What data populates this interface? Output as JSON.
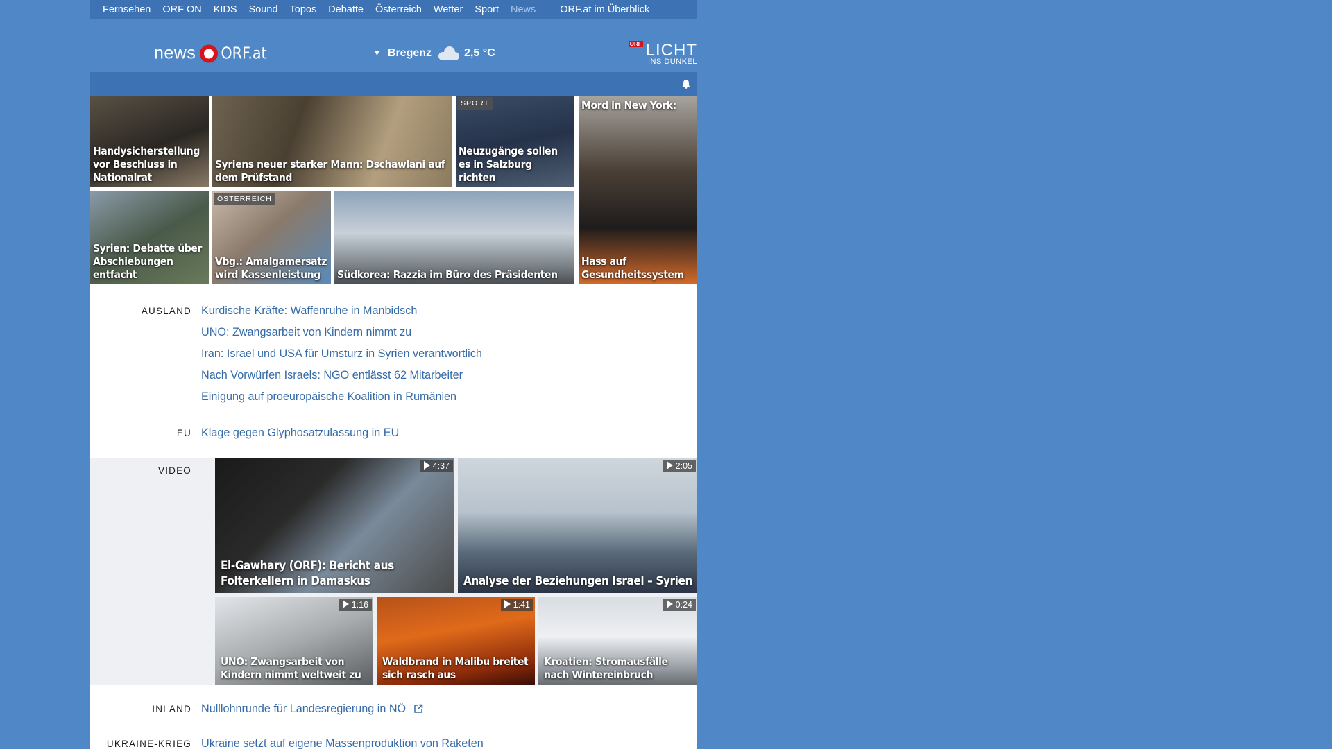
{
  "topnav": [
    "Fernsehen",
    "ORF ON",
    "KIDS",
    "Sound",
    "Topos",
    "Debatte",
    "Österreich",
    "Wetter",
    "Sport",
    "News"
  ],
  "topnav_right": "ORF.at im Überblick",
  "logo": {
    "news": "news",
    "orf": "ORF.at"
  },
  "weather": {
    "location": "Bregenz",
    "temp": "2,5 °C"
  },
  "licht": {
    "badge": "ORF",
    "title": "LICHT",
    "subtitle": "INS DUNKEL"
  },
  "tiles": [
    {
      "caption": "Handysicherstellung vor Beschluss in Nationalrat",
      "tag": ""
    },
    {
      "caption": "Syriens neuer starker Mann: Dschawlani auf dem Prüfstand",
      "tag": ""
    },
    {
      "caption": "Neuzugänge sollen es in Salzburg richten",
      "tag": "SPORT"
    },
    {
      "caption": "Mord in New York:",
      "tag": ""
    },
    {
      "caption": "Hass auf Gesundheitssystem",
      "tag": ""
    },
    {
      "caption": "Syrien: Debatte über Abschiebungen entfacht",
      "tag": ""
    },
    {
      "caption": "Vbg.: Amalgamersatz wird Kassenleistung",
      "tag": "ÖSTERREICH"
    },
    {
      "caption": "Südkorea: Razzia im Büro des Präsidenten",
      "tag": ""
    }
  ],
  "sections": {
    "ausland": {
      "label": "AUSLAND",
      "items": [
        "Kurdische Kräfte: Waffenruhe in Manbidsch",
        "UNO: Zwangsarbeit von Kindern nimmt zu",
        "Iran: Israel und USA für Umsturz in Syrien verantwortlich",
        "Nach Vorwürfen Israels: NGO entlässt 62 Mitarbeiter",
        "Einigung auf proeuropäische Koalition in Rumänien"
      ]
    },
    "eu": {
      "label": "EU",
      "items": [
        "Klage gegen Glyphosatzulassung in EU"
      ]
    },
    "inland": {
      "label": "INLAND",
      "items": [
        "Nulllohnrunde für Landesregierung in NÖ"
      ]
    },
    "ukraine": {
      "label": "UKRAINE-KRIEG",
      "items": [
        "Ukraine setzt auf eigene Massenproduktion von Raketen"
      ]
    }
  },
  "video": {
    "label": "VIDEO",
    "items": [
      {
        "caption": "El-Gawhary (ORF): Bericht aus Folterkellern in Damaskus",
        "duration": "4:37"
      },
      {
        "caption": "Analyse der Beziehungen Israel – Syrien",
        "duration": "2:05"
      },
      {
        "caption": "UNO: Zwangsarbeit von Kindern nimmt weltweit zu",
        "duration": "1:16"
      },
      {
        "caption": "Waldbrand in Malibu breitet sich rasch aus",
        "duration": "1:41"
      },
      {
        "caption": "Kroatien: Stromausfälle nach Wintereinbruch",
        "duration": "0:24"
      }
    ]
  },
  "colors": {
    "background": "#5088c7",
    "nav": "#3d73b5",
    "link": "#356ba8",
    "orf_red": "#d7141c"
  }
}
